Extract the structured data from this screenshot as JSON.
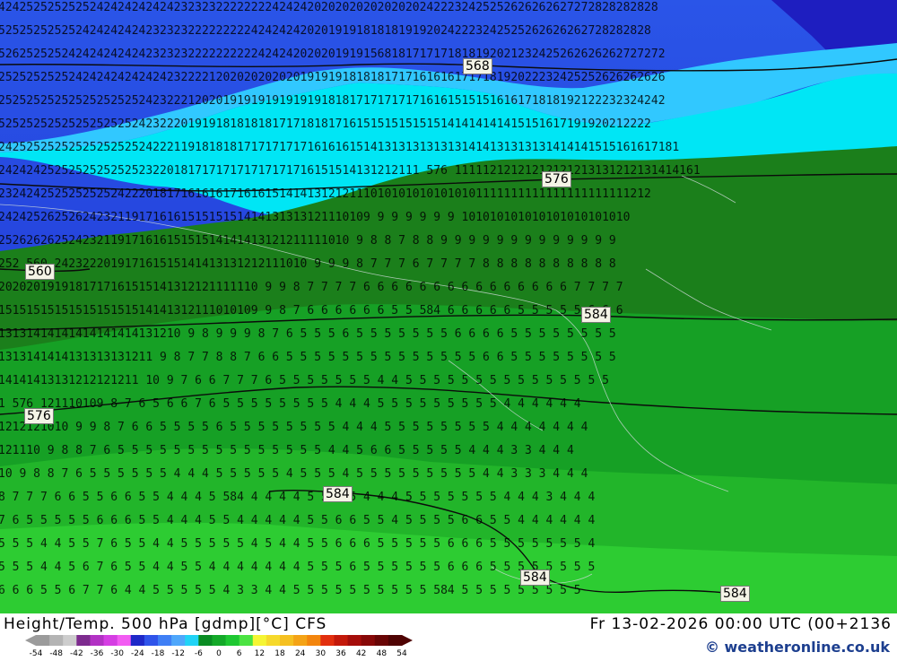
{
  "map": {
    "title": "Height/Temp. 500 hPa [gdmp][°C] CFS",
    "valid_time": "Fr 13-02-2026 00:00 UTC (00+2136",
    "credit": "© weatheronline.co.uk",
    "contour_labels": [
      "568",
      "576",
      "560",
      "584",
      "576",
      "584",
      "584",
      "584"
    ],
    "row_text": [
      "4242525252525242424242424232323222222224242420202020202020202422232425252626262627272828282828",
      "525252525252424242424232323222222222424242420201919181818191920242223242525262626262728282828",
      "52625252524242424242423232322222222224242420202019191568181717171818192021232425262626262727272",
      "25252525252424242424242423222212020202020201919191818181717161616171718192022232425252626262626",
      "25252525252525252525242322212020191919191919191818171717171716161515151616171818192122232324242",
      "525252525252525252524232220191918181818171718181716151515151515141414141415151617191920212222",
      "2425252525252525252524222119181818171717171716161615141313131313131414131313131414141515161617181",
      "242424252525252525252322018171717171717171716151514131212111 576 11111212121212121213131212131414161",
      "232424252525252524222018171616161716161514141312121110101010101010101111111111111111111111212",
      "24242526252624232119171616151515151414131313121110109 9 9 9 9 9 9 101010101010101010101010",
      "25262626252423211917161615151514141413121211111010 9 8 8 7 8 8 9 9 9 9 9 9 9 9 9 9 9 9 9",
      "252 560 242322201917161515141413131212111010 9 9 9 8 7 7 7 6 7 7 7 7 8 8 8 8 8 8 8 8 8 8",
      "2020201919181717161515141312121111110 9 9 8 7 7 7 7 6 6 6 6 6 6 6 6 6 6 6 6 6 6 6 7 7 7 7",
      "1515151515151515151514141312111010109 9 8 7 6 6 6 6 6 6 5 5 584 6 6 6 6 6 5 5 5 5 5 6 6 6",
      "13131414141414141414131210 9 8 9 9 9 8 7 6 5 5 5 6 5 5 5 5 5 5 5 6 6 6 6 5 5 5 5 5 5 5 5",
      "1313141414131313131211 9 8 7 7 8 8 7 6 6 5 5 5 5 5 5 5 5 5 5 5 5 5 5 6 6 5 5 5 5 5 5 5 5",
      "14141413131212121211 10 9 7 6 6 7 7 7 6 5 5 5 5 5 5 5 4 4 5 5 5 5 5 5 5 5 5 5 5 5 5 5 5",
      "1 576 121110109 8 7 6 5 6 6 7 6 5 5 5 5 5 5 5 5 4 4 4 5 5 5 5 5 5 5 5 5 4 4 4 4 4 4",
      "1212121010 9 9 8 7 6 6 5 5 5 5 6 5 5 5 5 5 5 5 5 4 4 4 5 5 5 5 5 5 5 5 4 4 4 4 4 4 4",
      "121110 9 8 8 7 6 5 5 5 5 5 5 5 5 5 5 5 5 5 5 5 4 4 5 6 6 5 5 5 5 5 4 4 4 3 3 4 4 4",
      "10 9 8 8 7 6 5 5 5 5 5 5 4 4 4 5 5 5 5 5 4 5 5 5 4 5 5 5 5 5 5 5 5 5 4 4 3 3 3 4 4 4",
      "8 7 7 7 6 6 5 5 6 6 5 5 4 4 4 5 584 4 4 4 4 5 5 6 5 4 4 4 5 5 5 5 5 5 5 4 4 4 3 4 4 4",
      "7 6 5 5 5 5 5 6 6 6 5 5 4 4 4 5 5 4 4 4 4 4 5 5 6 6 5 5 4 5 5 5 5 6 6 5 5 4 4 4 4 4 4",
      "5 5 5 4 4 5 5 7 6 5 5 4 4 5 5 5 5 5 4 5 4 4 5 5 6 6 6 5 5 5 5 5 6 6 6 5 5 5 5 5 5 5 4",
      "5 5 5 4 4 5 6 7 6 5 5 4 4 5 5 4 4 4 4 4 4 4 5 5 5 6 5 5 5 5 5 5 6 6 6 5 5 5 5 5 5 5 5",
      "6 6 6 5 5 6 7 7 6 4 4 5 5 5 5 5 4 3 3 4 4 5 5 5 5 5 5 5 5 5 5 584 5 5 5 5 5 5 5 5 5"
    ]
  },
  "legend": {
    "tick_labels": [
      "-54",
      "-48",
      "-42",
      "-36",
      "-30",
      "-24",
      "-18",
      "-12",
      "-6",
      "0",
      "6",
      "12",
      "18",
      "24",
      "30",
      "36",
      "42",
      "48",
      "54"
    ],
    "colors": [
      "#9b9b9b",
      "#b4b4b4",
      "#cdcdcd",
      "#7d2b8e",
      "#b232c4",
      "#d53ee3",
      "#f25cf2",
      "#1e28c8",
      "#2f54ea",
      "#3f7ff5",
      "#4fa7fb",
      "#21d3f6",
      "#0a8c23",
      "#14a929",
      "#1ec832",
      "#4be342",
      "#f5f534",
      "#f6d92b",
      "#f5c021",
      "#f4a316",
      "#f3850d",
      "#e22f0e",
      "#c3190a",
      "#a50d0a",
      "#870808",
      "#690505",
      "#4f0303"
    ]
  }
}
